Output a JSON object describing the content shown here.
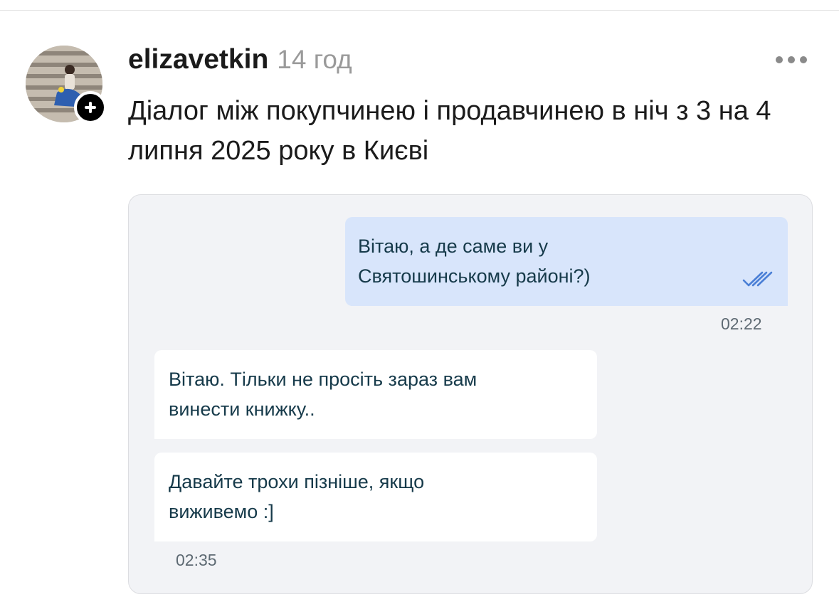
{
  "post": {
    "username": "elizavetkin",
    "time_ago": "14 год",
    "text": "Діалог між покупчинею і продавчинею в ніч з 3 на 4 липня 2025 року в Києві",
    "more_icon": "more-horizontal-icon",
    "follow_icon": "plus-icon"
  },
  "chat": {
    "messages": [
      {
        "direction": "outgoing",
        "text_line1": "Вітаю, а де саме ви у",
        "text_line2": "Святошинському районі?)",
        "status_icon": "double-check-icon",
        "time": "02:22"
      },
      {
        "direction": "incoming",
        "text_line1": "Вітаю. Тільки не просіть зараз вам",
        "text_line2": "винести книжку.."
      },
      {
        "direction": "incoming",
        "text_line1": "Давайте трохи пізніше, якщо",
        "text_line2": "виживемо :]",
        "time": "02:35"
      }
    ]
  },
  "colors": {
    "outgoing_bubble": "#d8e5fb",
    "incoming_bubble": "#ffffff",
    "card_background": "#f2f3f6",
    "check_color": "#4a7fd6",
    "time_ago_color": "#9a9a9a"
  }
}
